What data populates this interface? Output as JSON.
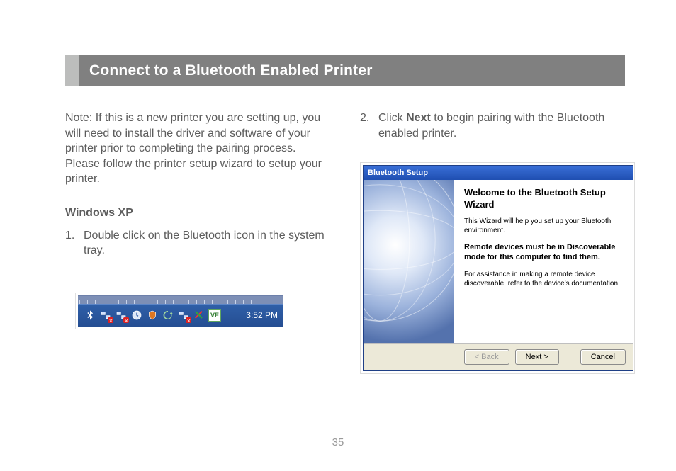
{
  "header": {
    "title": "Connect to a Bluetooth Enabled Printer"
  },
  "left": {
    "note": "Note: If this is a new printer you are setting up, you will need to install the driver and software of your printer prior to completing the pairing process. Please follow the printer setup wizard to setup your printer.",
    "subheading": "Windows XP",
    "step1_num": "1.",
    "step1_text": "Double click on the Bluetooth icon in the system tray."
  },
  "right": {
    "step2_num": "2.",
    "step2_pre": "Click ",
    "step2_bold": "Next",
    "step2_post": " to begin pairing with the Bluetooth enabled printer."
  },
  "tray": {
    "icons": [
      "bluetooth-icon",
      "network-icon",
      "network-icon",
      "clock-icon",
      "shield-icon",
      "refresh-icon",
      "network-icon",
      "antivirus-icon",
      "app-icon"
    ],
    "ve_label": "VE",
    "time": "3:52 PM"
  },
  "wizard": {
    "titlebar": "Bluetooth Setup",
    "title": "Welcome to the Bluetooth Setup Wizard",
    "intro": "This Wizard will help you set up your Bluetooth environment.",
    "bold_note": "Remote devices must be in Discoverable mode for this computer to find them.",
    "assist": "For assistance in making a remote device discoverable, refer to the device's documentation.",
    "back": "< Back",
    "next": "Next >",
    "cancel": "Cancel"
  },
  "page_number": "35"
}
